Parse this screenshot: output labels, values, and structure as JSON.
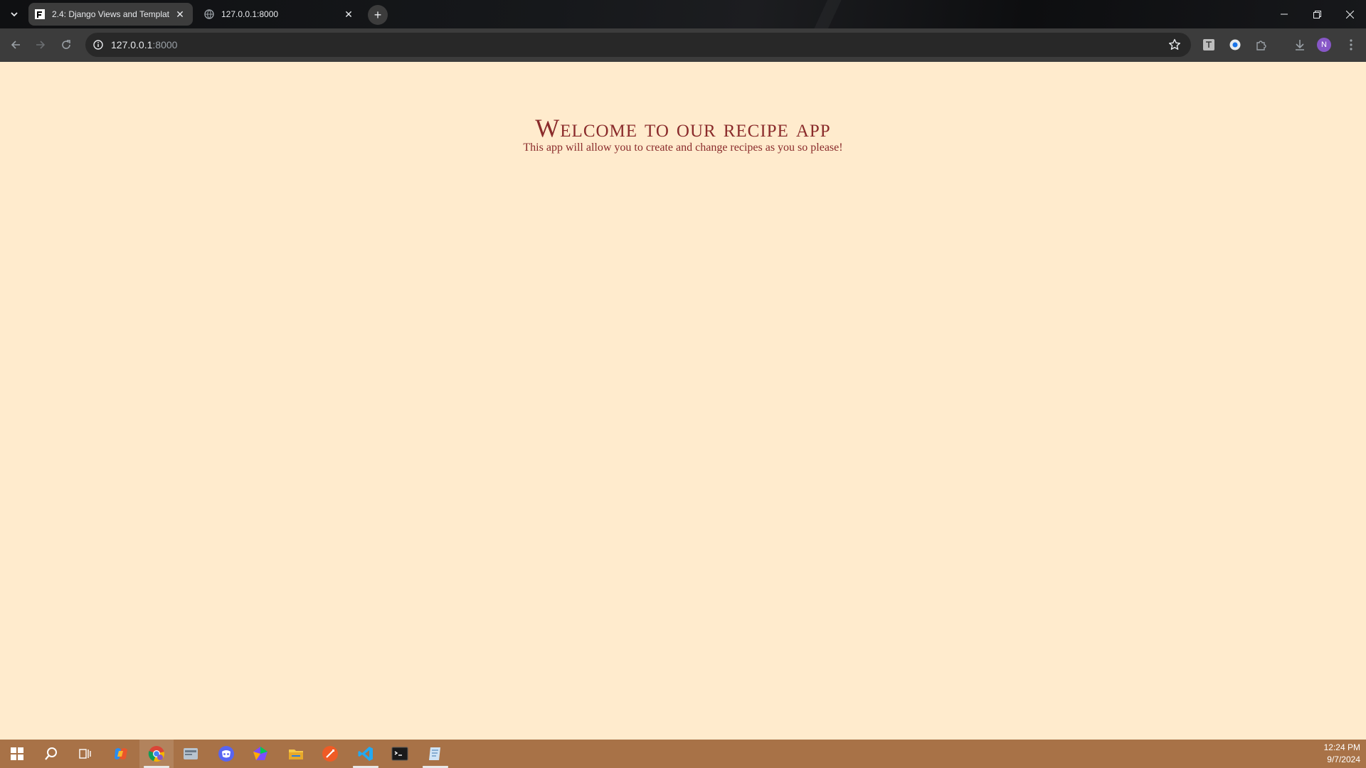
{
  "browser": {
    "tabs": [
      {
        "title": "2.4: Django Views and Templat",
        "active": true
      },
      {
        "title": "127.0.0.1:8000",
        "active": false
      }
    ],
    "address": {
      "host": "127.0.0.1",
      "port": ":8000"
    },
    "profile_initial": "N"
  },
  "page": {
    "heading": "Welcome to our recipe app",
    "subtitle": "This app will allow you to create and change recipes as you so please!"
  },
  "colors": {
    "page_background": "#ffebcd",
    "text": "#8a2b2b",
    "taskbar": "#a87247",
    "toolbar": "#3c3c3c"
  },
  "taskbar": {
    "apps": [
      "start-icon",
      "search-icon",
      "task-view-icon",
      "copilot-icon",
      "chrome-icon",
      "files-app-icon",
      "discord-icon",
      "app-icon",
      "file-explorer-icon",
      "postman-icon",
      "vscode-icon",
      "terminal-icon",
      "notes-icon"
    ],
    "time": "12:24 PM",
    "date": "9/7/2024"
  }
}
